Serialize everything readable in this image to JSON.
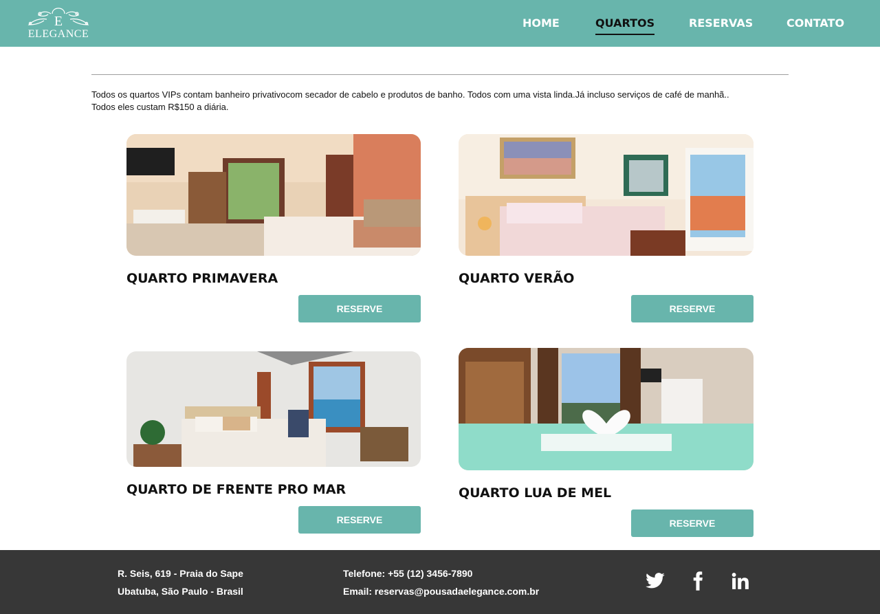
{
  "brand": {
    "letter": "E",
    "name": "ELEGANCE"
  },
  "nav": {
    "items": [
      {
        "label": "HOME"
      },
      {
        "label": "QUARTOS"
      },
      {
        "label": "RESERVAS"
      },
      {
        "label": "CONTATO"
      }
    ],
    "active": "QUARTOS"
  },
  "intro": {
    "line1": "Todos os quartos VIPs contam banheiro privativocom secador de cabelo e produtos de banho. Todos com uma vista linda.Já incluso serviços de café de manhã..",
    "line2": "Todos eles custam R$150 a diária."
  },
  "rooms": [
    {
      "title": "QUARTO PRIMAVERA",
      "button": "RESERVE"
    },
    {
      "title": "QUARTO VERÃO",
      "button": "RESERVE"
    },
    {
      "title": "QUARTO DE FRENTE PRO MAR",
      "button": "RESERVE"
    },
    {
      "title": "QUARTO LUA DE MEL",
      "button": "RESERVE"
    }
  ],
  "footer": {
    "address_line1": "R. Seis, 619 - Praia do Sape",
    "address_line2": "Ubatuba, São Paulo - Brasil",
    "phone": "Telefone: +55 (12) 3456-7890",
    "email": "Email: reservas@pousadaelegance.com.br",
    "social": [
      "twitter-icon",
      "facebook-icon",
      "linkedin-icon"
    ]
  },
  "colors": {
    "accent": "#68b5ac",
    "footer": "#373737",
    "text": "#111111"
  }
}
